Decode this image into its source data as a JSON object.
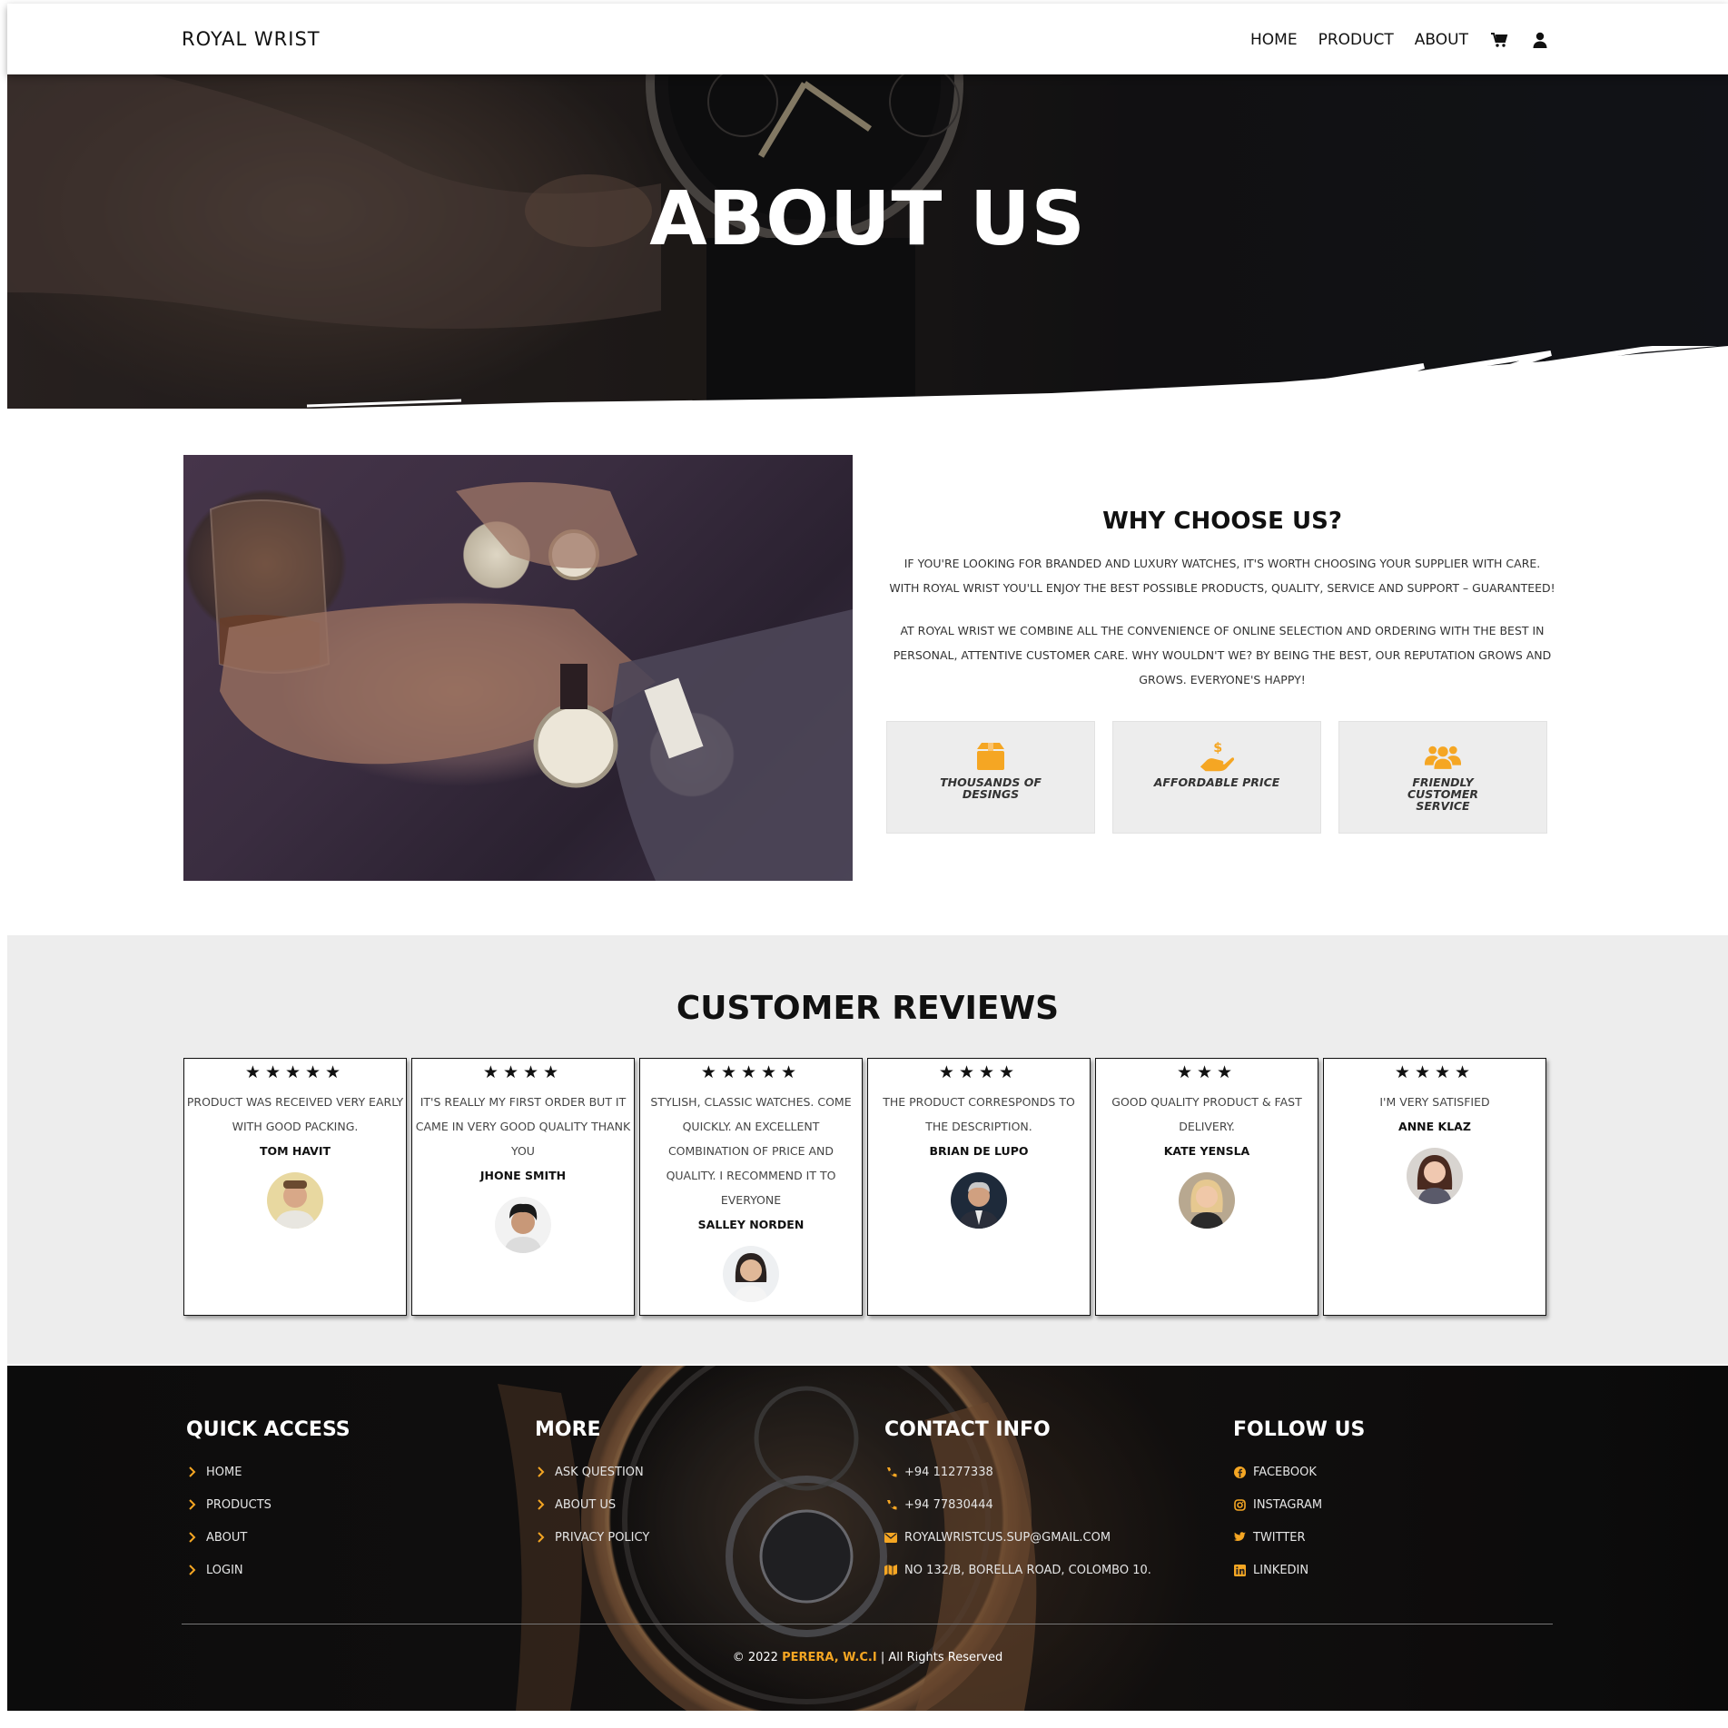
{
  "brand": "ROYAL WRIST",
  "nav": {
    "home": "HOME",
    "product": "PRODUCT",
    "about": "ABOUT"
  },
  "hero": {
    "title": "ABOUT US"
  },
  "why": {
    "title": "WHY CHOOSE US?",
    "p1_l1": "IF YOU'RE LOOKING FOR BRANDED AND LUXURY WATCHES, IT'S WORTH CHOOSING YOUR SUPPLIER WITH CARE.",
    "p1_l2": "WITH ROYAL WRIST YOU'LL ENJOY THE BEST POSSIBLE PRODUCTS, QUALITY, SERVICE AND SUPPORT – GUARANTEED!",
    "p2_l1": "AT ROYAL WRIST WE COMBINE ALL THE CONVENIENCE OF ONLINE SELECTION AND ORDERING WITH THE BEST IN",
    "p2_l2": "PERSONAL, ATTENTIVE CUSTOMER CARE. WHY WOULDN'T WE? BY BEING THE BEST, OUR REPUTATION GROWS AND",
    "p2_l3": "GROWS. EVERYONE'S HAPPY!",
    "features": [
      {
        "label": "THOUSANDS OF DESINGS",
        "icon": "box-icon"
      },
      {
        "label": "AFFORDABLE PRICE",
        "icon": "hand-dollar-icon"
      },
      {
        "label": "FRIENDLY CUSTOMER SERVICE",
        "icon": "users-icon"
      }
    ],
    "accent": "#f5a623"
  },
  "reviews": {
    "title": "CUSTOMER REVIEWS",
    "items": [
      {
        "stars": "★★★★★",
        "rating": 5,
        "text": "PRODUCT WAS RECEIVED VERY EARLY WITH GOOD PACKING.",
        "name": "TOM HAVIT"
      },
      {
        "stars": "★★★★",
        "rating": 4,
        "text": "IT'S REALLY MY FIRST ORDER BUT IT CAME IN VERY GOOD QUALITY THANK YOU",
        "name": "JHONE SMITH"
      },
      {
        "stars": "★★★★★",
        "rating": 5,
        "text": "STYLISH, CLASSIC WATCHES. COME QUICKLY. AN EXCELLENT COMBINATION OF PRICE AND QUALITY. I RECOMMEND IT TO EVERYONE",
        "name": "SALLEY NORDEN"
      },
      {
        "stars": "★★★★",
        "rating": 4,
        "text": "THE PRODUCT CORRESPONDS TO THE DESCRIPTION.",
        "name": "BRIAN DE LUPO"
      },
      {
        "stars": "★★★",
        "rating": 3,
        "text": "GOOD QUALITY PRODUCT & FAST DELIVERY.",
        "name": "KATE YENSLA"
      },
      {
        "stars": "★★★★",
        "rating": 4,
        "text": "I'M VERY SATISFIED",
        "name": "ANNE KLAZ"
      }
    ]
  },
  "footer": {
    "quick": {
      "title": "QUICK ACCESS",
      "items": [
        "HOME",
        "PRODUCTS",
        "ABOUT",
        "LOGIN"
      ]
    },
    "more": {
      "title": "MORE",
      "items": [
        "ASK QUESTION",
        "ABOUT US",
        "PRIVACY POLICY"
      ]
    },
    "contact": {
      "title": "CONTACT INFO",
      "items": [
        "+94 11277338",
        "+94 77830444",
        "ROYALWRISTCUS.SUP@GMAIL.COM",
        "NO 132/B, BORELLA ROAD, COLOMBO 10."
      ]
    },
    "follow": {
      "title": "FOLLOW US",
      "items": [
        "FACEBOOK",
        "INSTAGRAM",
        "TWITTER",
        "LINKEDIN"
      ]
    },
    "copy_pre": "© 2022",
    "copy_name": "PERERA, W.C.I",
    "copy_post": "| All Rights Reserved"
  }
}
